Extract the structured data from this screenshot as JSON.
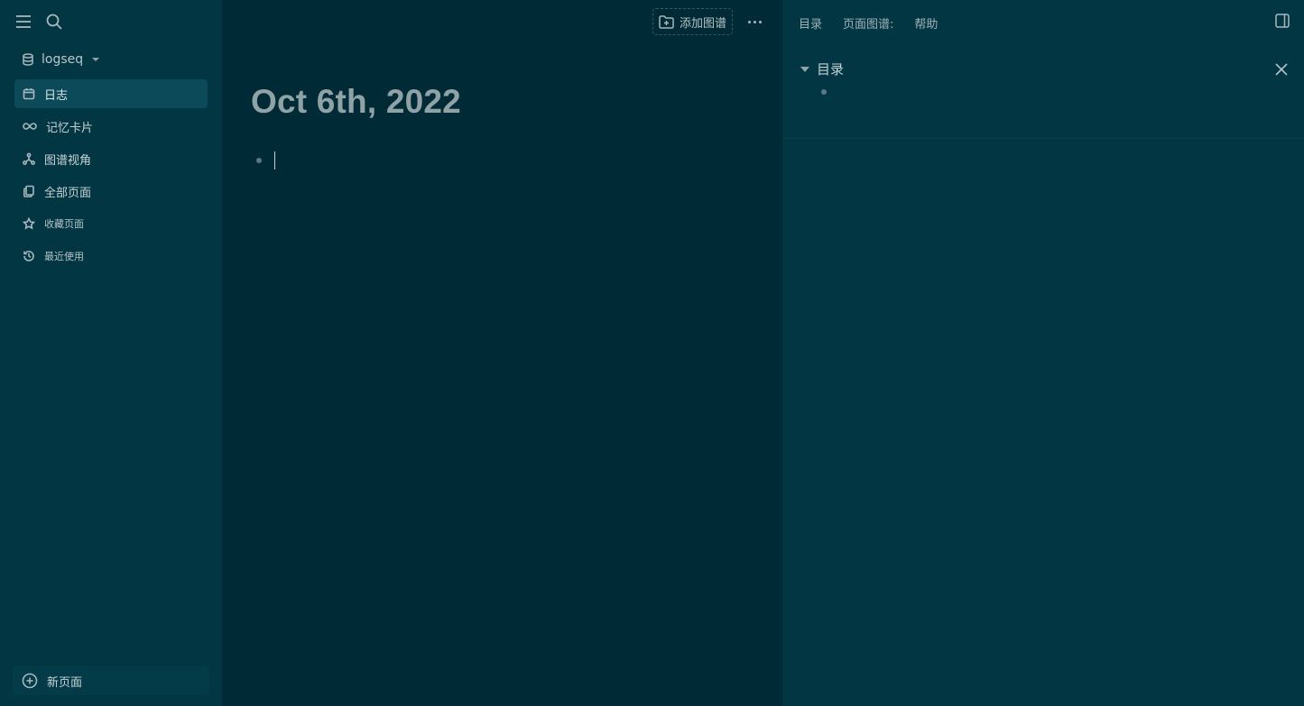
{
  "sidebar": {
    "graph_name": "logseq",
    "nav_items": [
      {
        "label": "日志"
      },
      {
        "label": "记忆卡片"
      },
      {
        "label": "图谱视角"
      },
      {
        "label": "全部页面"
      },
      {
        "label": "收藏页面"
      },
      {
        "label": "最近使用"
      }
    ],
    "new_page_label": "新页面"
  },
  "main": {
    "add_graph_label": "添加图谱",
    "page_title": "Oct 6th, 2022"
  },
  "right_sidebar": {
    "tabs": [
      {
        "label": "目录"
      },
      {
        "label": "页面图谱:"
      },
      {
        "label": "帮助"
      }
    ],
    "toc_title": "目录"
  },
  "colors": {
    "sidebar_bg": "#023643",
    "main_bg": "#002b36",
    "active_item_bg": "#0c4a59",
    "title_color": "#8fa3a7"
  },
  "icons": [
    "menu-icon",
    "search-icon",
    "database-icon",
    "calendar-icon",
    "infinity-icon",
    "graph-icon",
    "pages-icon",
    "star-icon",
    "history-icon",
    "plus-circle-icon",
    "folder-plus-icon",
    "more-icon",
    "sidebar-toggle-icon",
    "close-icon"
  ]
}
